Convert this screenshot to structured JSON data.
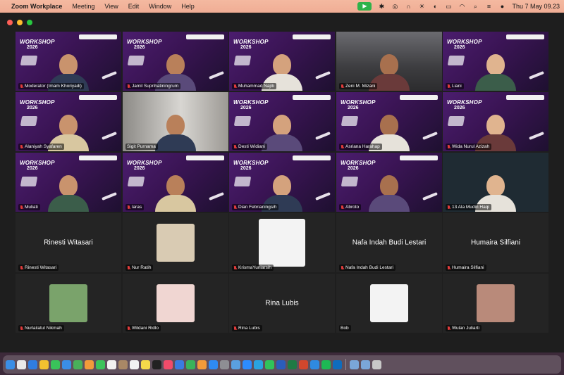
{
  "menubar": {
    "app_name": "Zoom Workplace",
    "menus": [
      "Meeting",
      "View",
      "Edit",
      "Window",
      "Help"
    ],
    "clock": "Thu 7 May  09.23",
    "status_icons": [
      "facetime-icon",
      "bluetooth-icon",
      "airdrop-icon",
      "headphones-icon",
      "brightness-icon",
      "focus-icon",
      "battery-icon",
      "wifi-icon",
      "search-icon",
      "control-center-icon",
      "user-icon"
    ]
  },
  "banner": {
    "title": "WORKSHOP",
    "year": "2026"
  },
  "participants": [
    {
      "name": "Moderator (Imam Khoriyadi)",
      "view": "video-banner",
      "muted": true
    },
    {
      "name": "Jamil Suprihatiningrum",
      "view": "video-banner",
      "muted": true
    },
    {
      "name": "Muhammad Najib",
      "view": "video-banner",
      "muted": true
    },
    {
      "name": "Zeni M. Mizani",
      "view": "video-room",
      "muted": true
    },
    {
      "name": "Liani",
      "view": "video-banner",
      "muted": true
    },
    {
      "name": "Alaniyah Syafaren",
      "view": "video-banner",
      "muted": true
    },
    {
      "name": "Sigit Purnama",
      "view": "video-room-light",
      "muted": false,
      "active_speaker": true
    },
    {
      "name": "Desti Widiani",
      "view": "video-banner",
      "muted": true
    },
    {
      "name": "Asriana Harahap",
      "view": "video-banner",
      "muted": true
    },
    {
      "name": "Wida Nurul Azizah",
      "view": "video-banner",
      "muted": true
    },
    {
      "name": "Muliati",
      "view": "video-banner",
      "muted": true
    },
    {
      "name": "laras",
      "view": "video-banner",
      "muted": true
    },
    {
      "name": "Dian Febrianingsih",
      "view": "video-banner",
      "muted": true
    },
    {
      "name": "Abroto",
      "view": "video-banner",
      "muted": true
    },
    {
      "name": "13 Ala Mudin Haqi",
      "view": "video-dark",
      "muted": true
    },
    {
      "name": "Rinesti Witasari",
      "view": "name-only",
      "muted": true
    },
    {
      "name": "Nur Ratih",
      "view": "avatar",
      "muted": true
    },
    {
      "name": "KrismaYuniarsih",
      "view": "avatar",
      "muted": true
    },
    {
      "name": "Nafa Indah Budi Lestari",
      "view": "name-only",
      "muted": true
    },
    {
      "name": "Humaira Silfiani",
      "view": "name-only",
      "muted": true
    },
    {
      "name": "Nurlailatul Nikmah",
      "view": "avatar",
      "muted": true
    },
    {
      "name": "Wildani Ridlo",
      "view": "avatar",
      "muted": true
    },
    {
      "name": "Rina Lubis",
      "view": "name-only",
      "muted": true
    },
    {
      "name": "Bob",
      "view": "avatar",
      "muted": false
    },
    {
      "name": "Wulan Juliarti",
      "view": "avatar",
      "muted": true
    }
  ],
  "dock": {
    "icons": [
      "finder-icon",
      "launchpad-icon",
      "safari-icon",
      "chrome-icon",
      "messages-icon",
      "mail-icon",
      "maps-icon",
      "photos-icon",
      "facetime-icon",
      "calendar-icon",
      "contacts-icon",
      "reminders-icon",
      "notes-icon",
      "tv-icon",
      "music-icon",
      "keynote-icon",
      "numbers-icon",
      "pages-icon",
      "app-store-icon",
      "settings-icon",
      "preview-icon",
      "zoom-icon",
      "telegram-icon",
      "whatsapp-icon",
      "word-icon",
      "excel-icon",
      "powerpoint-icon",
      "edge-icon",
      "spotify-icon",
      "outlook-icon",
      "folder-icon",
      "folder-icon",
      "trash-icon"
    ]
  }
}
